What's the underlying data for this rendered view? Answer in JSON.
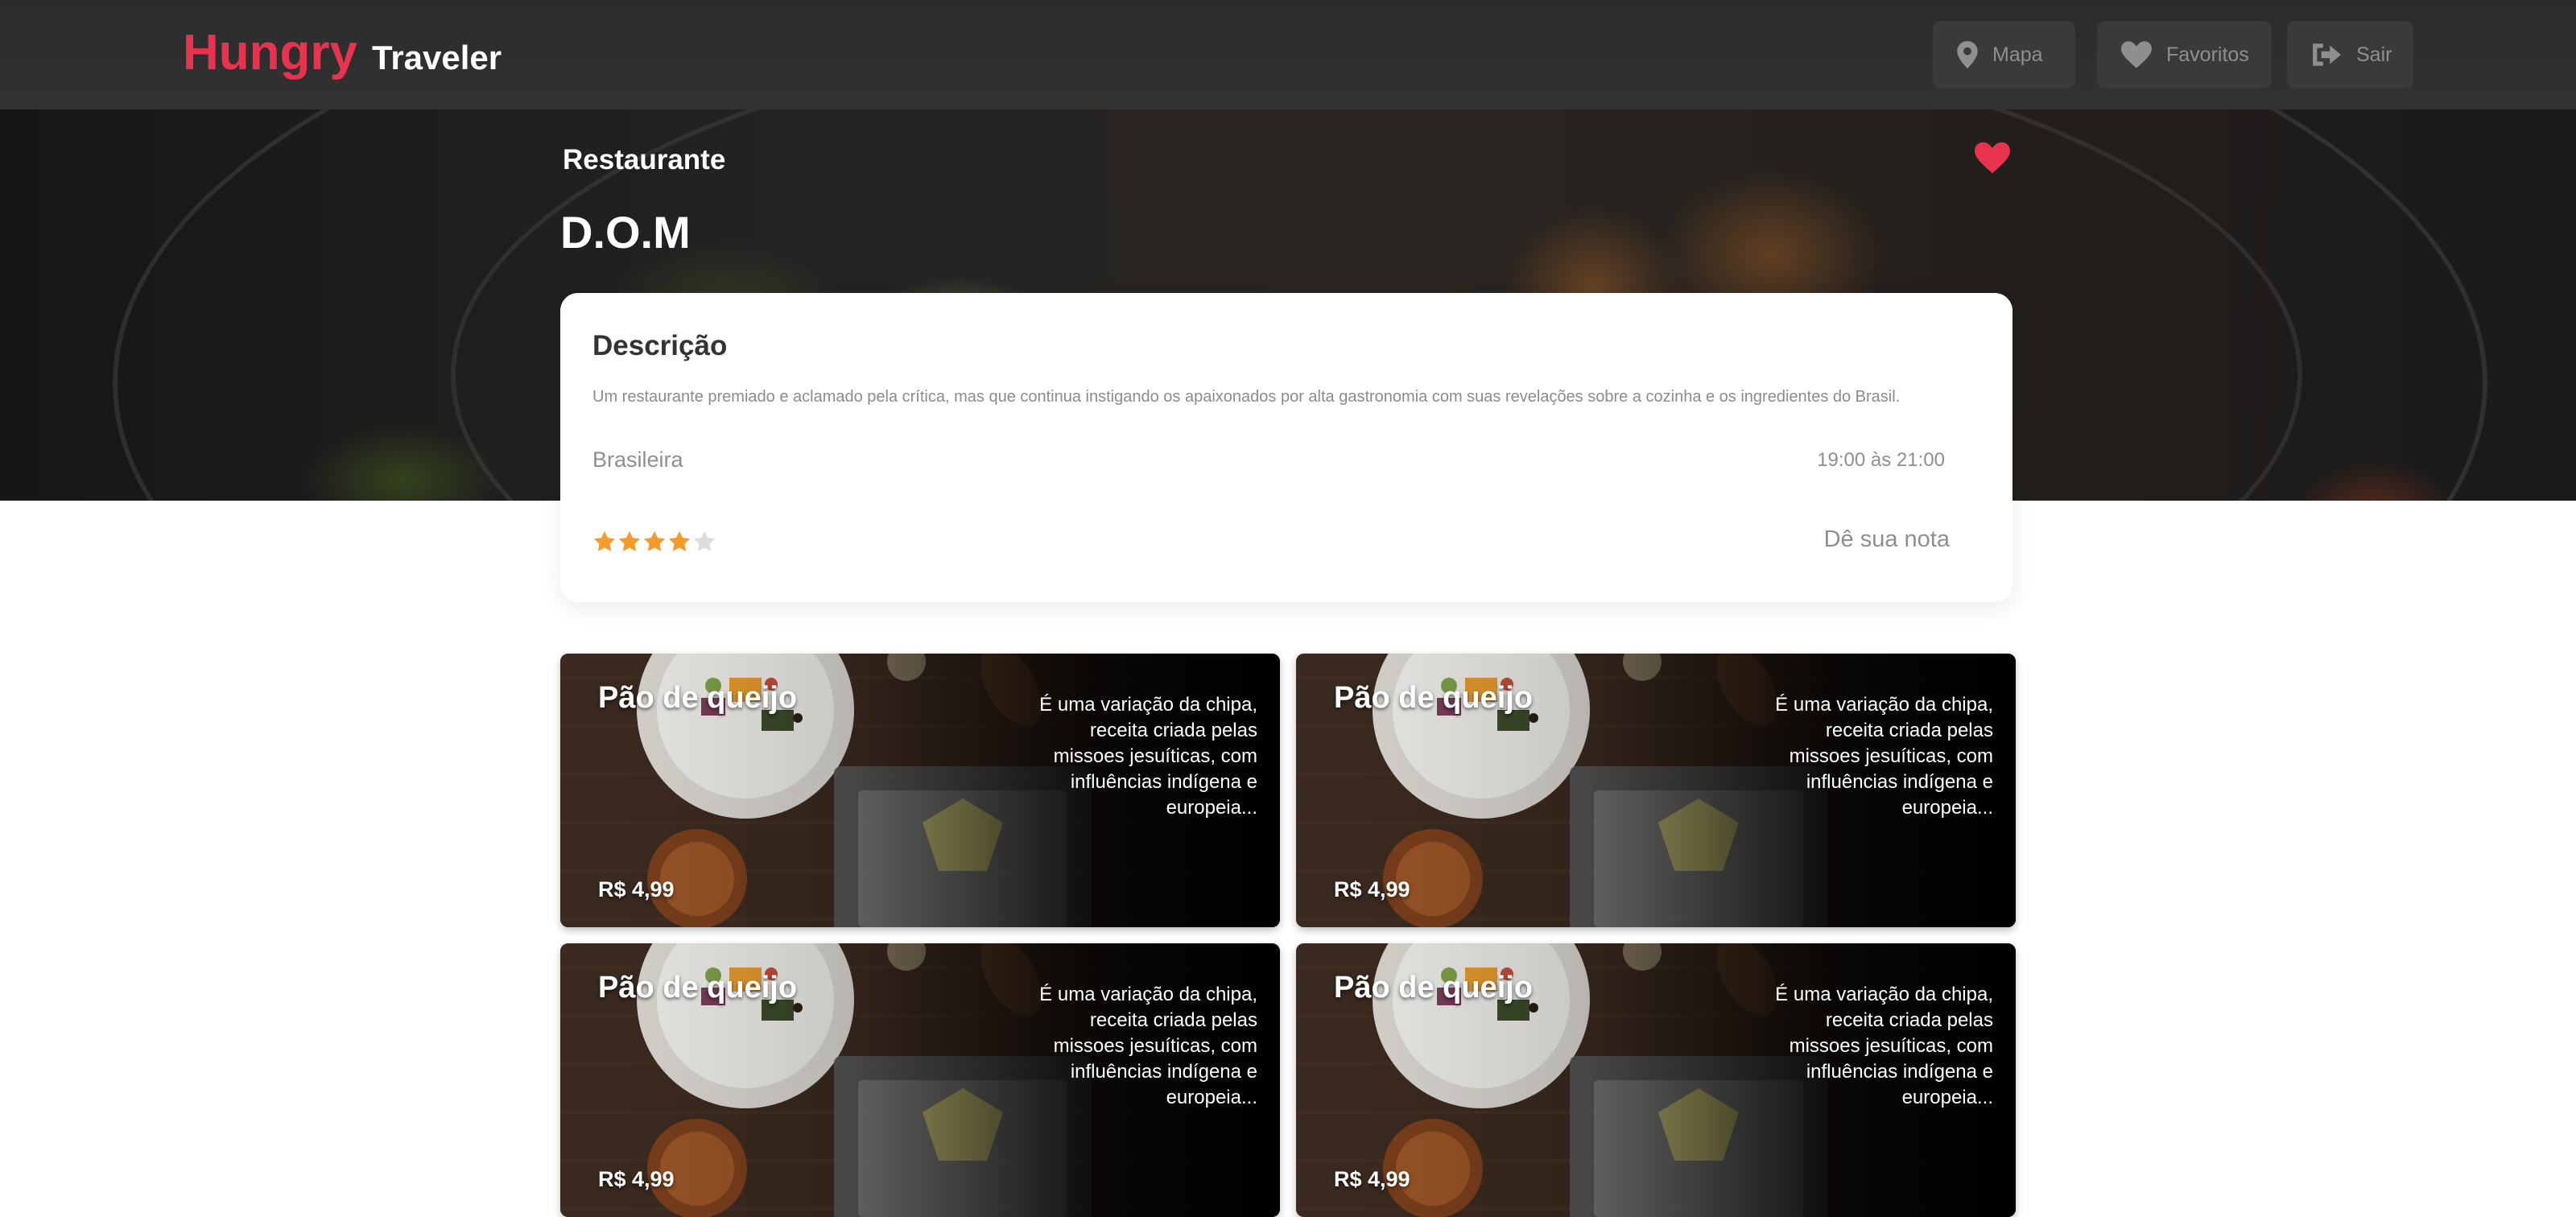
{
  "header": {
    "brand_main": "Hungry",
    "brand_sub": "Traveler",
    "nav": [
      {
        "label": "Mapa",
        "icon": "map-pin-icon"
      },
      {
        "label": "Favoritos",
        "icon": "heart-icon"
      },
      {
        "label": "Sair",
        "icon": "sign-out-icon"
      }
    ]
  },
  "hero": {
    "label": "Restaurante",
    "title": "D.O.M",
    "favorite_icon": "heart-icon",
    "favorite_color": "#e8334f"
  },
  "description": {
    "heading": "Descrição",
    "text": "Um restaurante premiado e aclamado pela crítica, mas que continua instigando os apaixonados por alta gastronomia com suas revelações sobre a cozinha e os ingredientes do Brasil.",
    "cuisine": "Brasileira",
    "hours": "19:00 às 21:00",
    "rating": 4,
    "rating_max": 5,
    "rate_label": "Dê sua nota",
    "star_color": "#f39c2b"
  },
  "menu": [
    {
      "name": "Pão de queijo",
      "description": "É uma variação da chipa, receita criada pelas missoes jesuíticas, com influências indígena e europeia...",
      "price": "R$ 4,99"
    },
    {
      "name": "Pão de queijo",
      "description": "É uma variação da chipa, receita criada pelas missoes jesuíticas, com influências indígena e europeia...",
      "price": "R$ 4,99"
    },
    {
      "name": "Pão de queijo",
      "description": "É uma variação da chipa, receita criada pelas missoes jesuíticas, com influências indígena e europeia...",
      "price": "R$ 4,99"
    },
    {
      "name": "Pão de queijo",
      "description": "É uma variação da chipa, receita criada pelas missoes jesuíticas, com influências indígena e europeia...",
      "price": "R$ 4,99"
    }
  ],
  "colors": {
    "brand_accent": "#e8334f",
    "navbar_bg": "#2e2e2e",
    "nav_button_bg": "#3a3a3a"
  }
}
